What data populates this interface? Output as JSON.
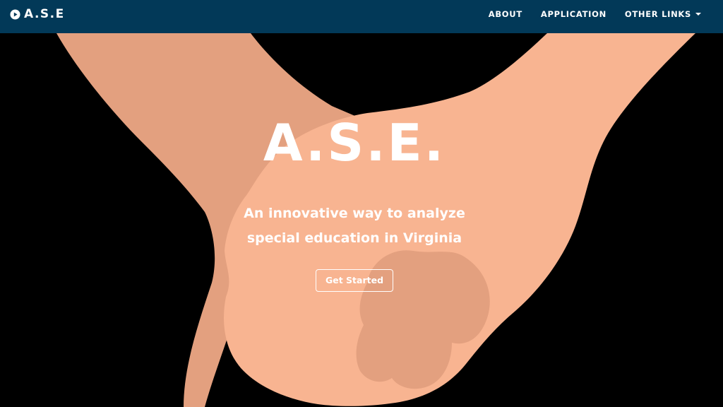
{
  "navbar": {
    "brand_text": "A.S.E",
    "brand_icon": "play-circle-icon",
    "links": [
      {
        "label": "ABOUT"
      },
      {
        "label": "APPLICATION"
      },
      {
        "label": "OTHER LINKS",
        "has_caret": true
      }
    ],
    "background_color": "#023958"
  },
  "hero": {
    "title": "A.S.E.",
    "subtitle_line1": "An innovative way to analyze",
    "subtitle_line2": "special education in Virginia",
    "cta_label": "Get Started",
    "image": "holding-hands-illustration",
    "skin_light_color": "#F8B491",
    "skin_dark_color": "#E3A07F",
    "background_color": "#000000"
  }
}
